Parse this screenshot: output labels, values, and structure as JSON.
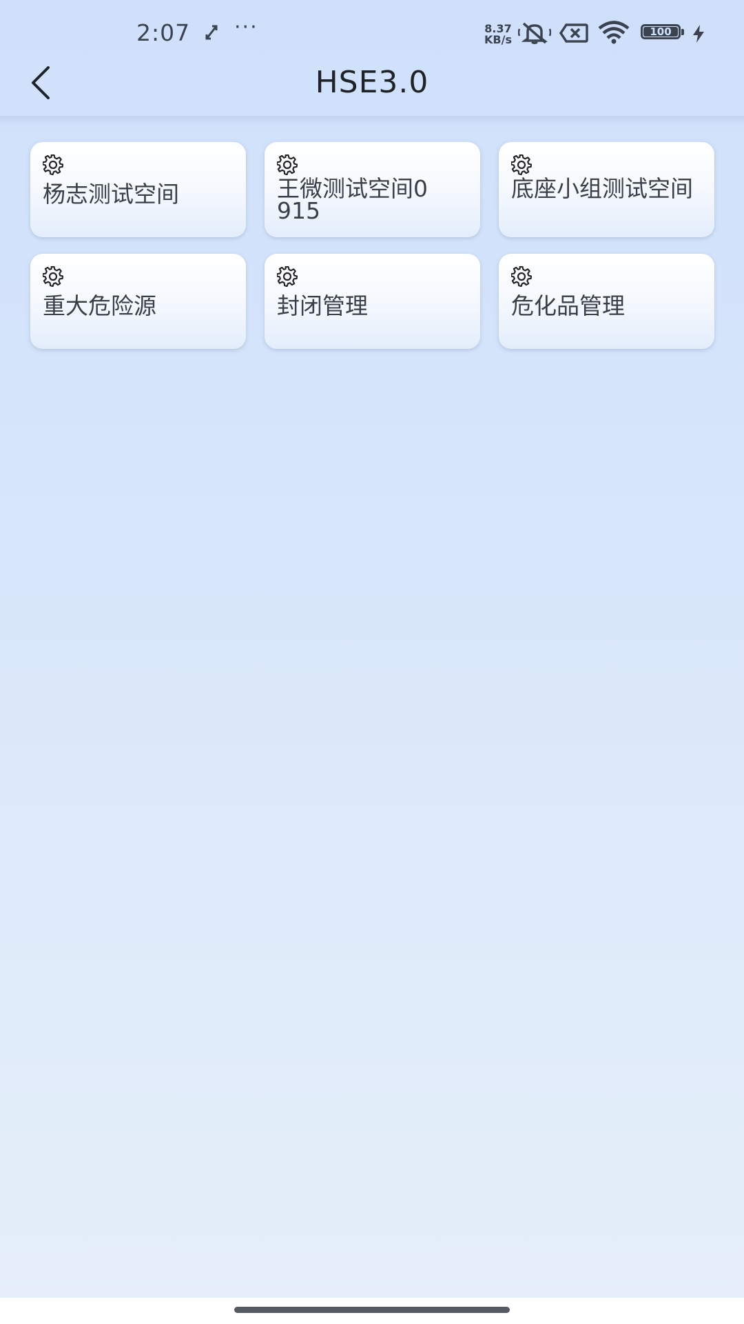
{
  "status_bar": {
    "time": "2:07",
    "more": "···",
    "speed_value": "8.37",
    "speed_unit": "KB/s",
    "battery": "100",
    "icons": [
      "rotate-icon",
      "mute-icon",
      "sim-off-icon",
      "wifi-icon",
      "battery-icon",
      "charging-icon"
    ]
  },
  "header": {
    "title": "HSE3.0",
    "back_icon": "chevron-left-icon"
  },
  "cards": [
    {
      "label": "杨志测试空间",
      "icon": "gear-icon"
    },
    {
      "label": "王微测试空间0915",
      "icon": "gear-icon"
    },
    {
      "label": "底座小组测试空间",
      "icon": "gear-icon"
    },
    {
      "label": "重大危险源",
      "icon": "gear-icon"
    },
    {
      "label": "封闭管理",
      "icon": "gear-icon"
    },
    {
      "label": "危化品管理",
      "icon": "gear-icon"
    }
  ]
}
